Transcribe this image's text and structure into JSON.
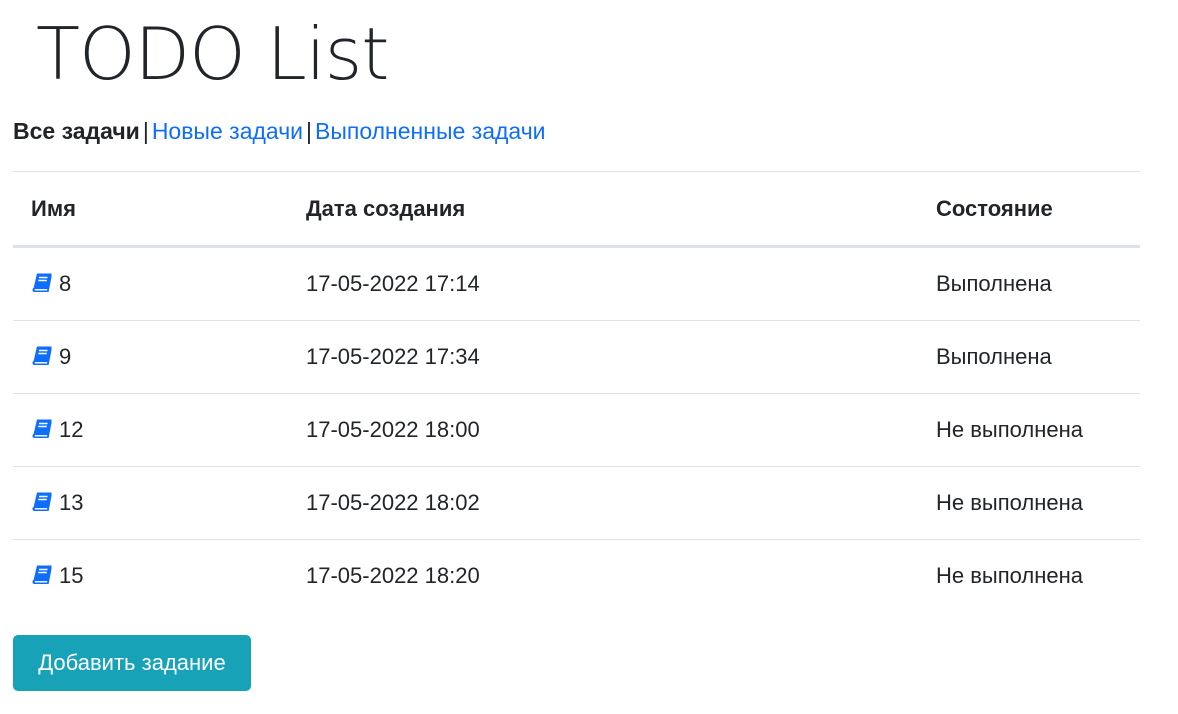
{
  "header": {
    "title": "TODO List"
  },
  "filters": {
    "all_label": "Все задачи",
    "new_label": "Новые задачи",
    "done_label": "Выполненные задачи",
    "separator": "|"
  },
  "table": {
    "columns": {
      "name": "Имя",
      "date": "Дата создания",
      "state": "Состояние"
    },
    "row_icon": "book-icon",
    "rows": [
      {
        "name": "8",
        "date": "17-05-2022 17:14",
        "state": "Выполнена"
      },
      {
        "name": "9",
        "date": "17-05-2022 17:34",
        "state": "Выполнена"
      },
      {
        "name": "12",
        "date": "17-05-2022 18:00",
        "state": "Не выполнена"
      },
      {
        "name": "13",
        "date": "17-05-2022 18:02",
        "state": "Не выполнена"
      },
      {
        "name": "15",
        "date": "17-05-2022 18:20",
        "state": "Не выполнена"
      }
    ]
  },
  "actions": {
    "add_task_label": "Добавить задание"
  },
  "colors": {
    "link": "#0d6efd",
    "icon": "#0d6efd",
    "button": "#17a2b8",
    "text": "#212529",
    "border": "#dee2e6"
  }
}
